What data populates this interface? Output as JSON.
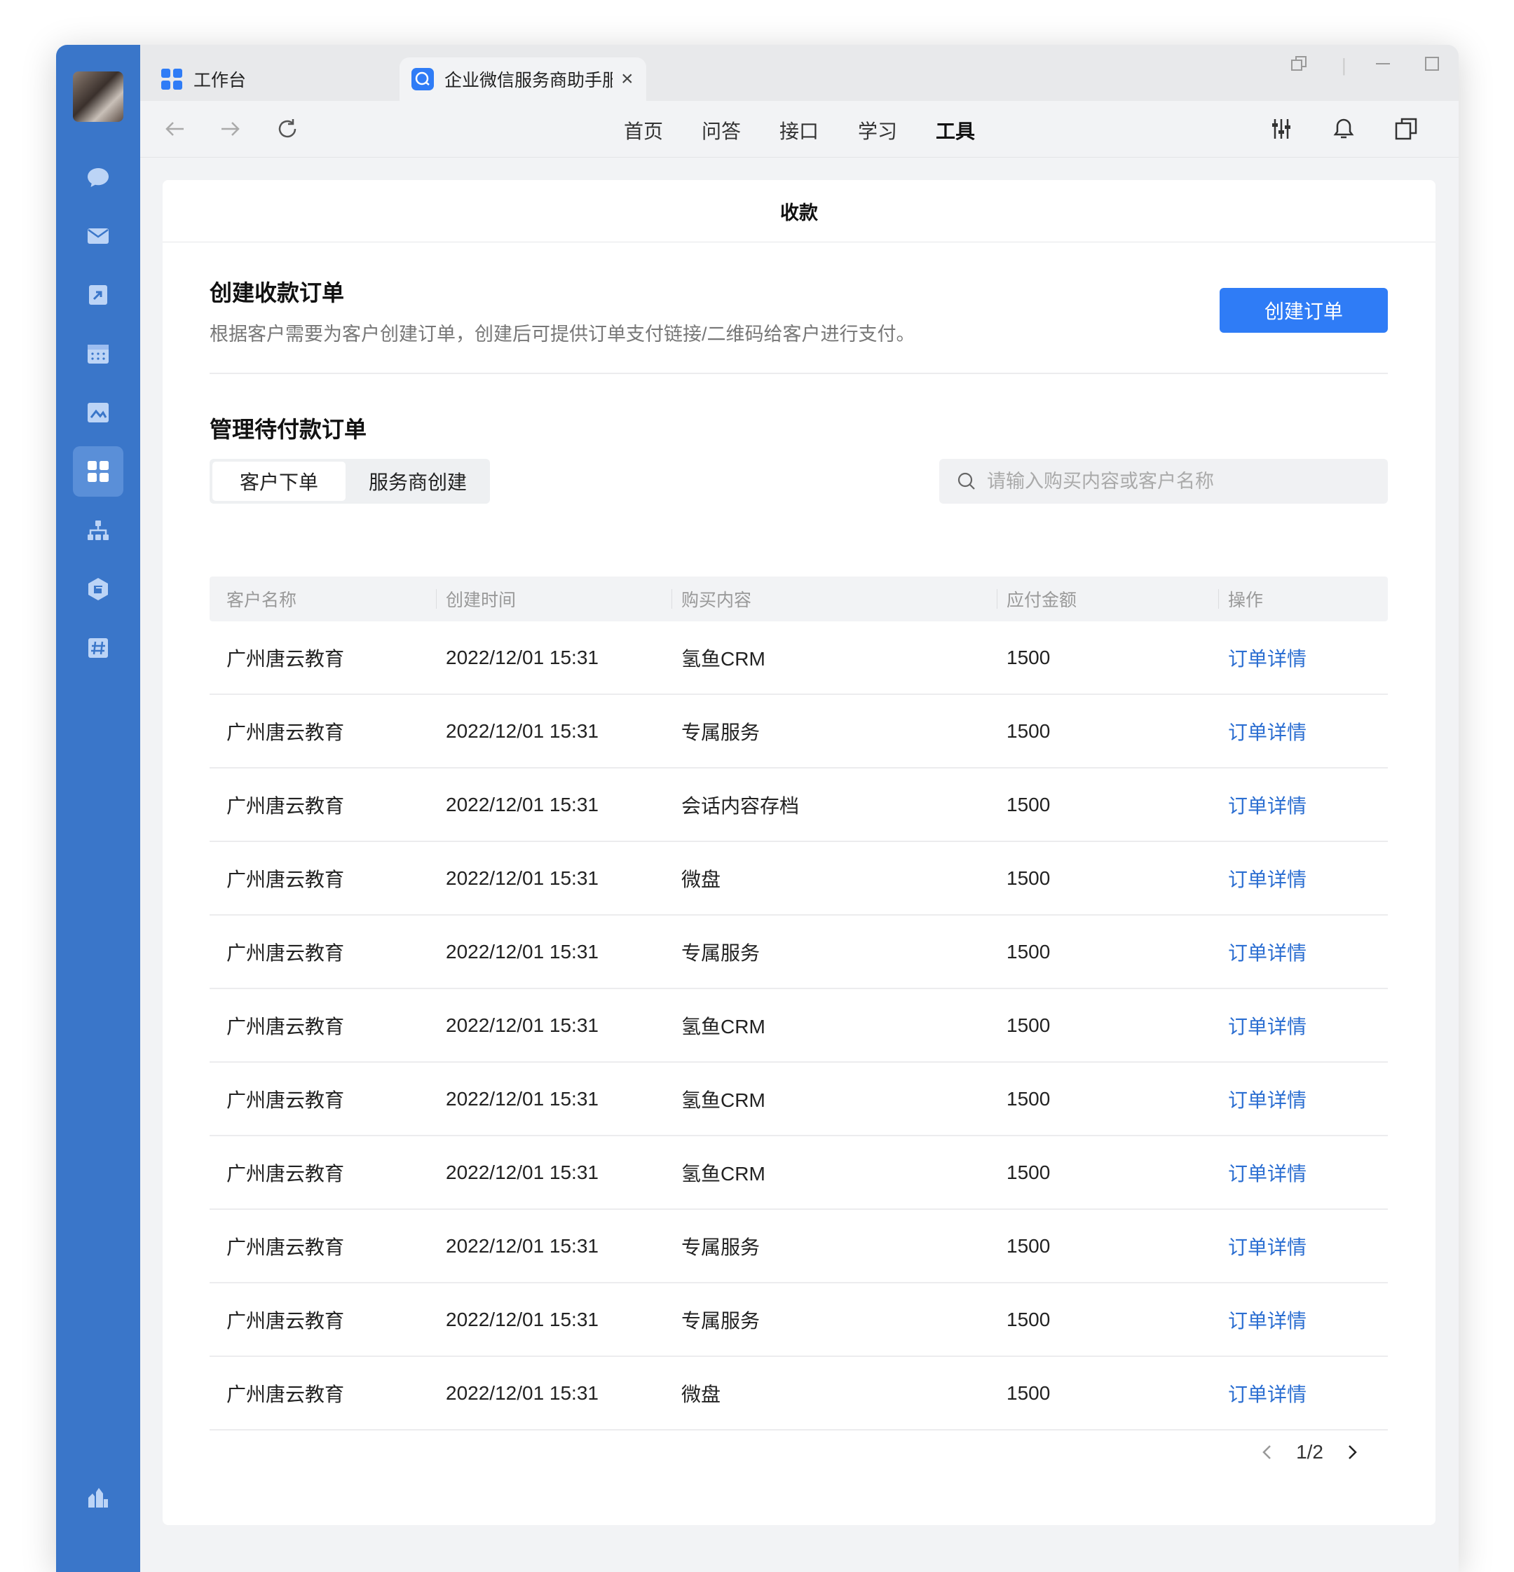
{
  "tabs": [
    {
      "label": "工作台"
    },
    {
      "label": "企业微信服务商助手服"
    }
  ],
  "nav": {
    "menu": [
      "首页",
      "问答",
      "接口",
      "学习",
      "工具"
    ],
    "active": "工具"
  },
  "page": {
    "title": "收款",
    "create": {
      "heading": "创建收款订单",
      "description": "根据客户需要为客户创建订单，创建后可提供订单支付链接/二维码给客户进行支付。",
      "button": "创建订单"
    },
    "manage": {
      "heading": "管理待付款订单",
      "segments": [
        "客户下单",
        "服务商创建"
      ],
      "search_placeholder": "请输入购买内容或客户名称"
    },
    "table": {
      "columns": [
        "客户名称",
        "创建时间",
        "购买内容",
        "应付金额",
        "操作"
      ],
      "rows": [
        {
          "customer": "广州唐云教育",
          "time": "2022/12/01 15:31",
          "item": "氢鱼CRM",
          "amount": "1500",
          "action": "订单详情"
        },
        {
          "customer": "广州唐云教育",
          "time": "2022/12/01 15:31",
          "item": "专属服务",
          "amount": "1500",
          "action": "订单详情"
        },
        {
          "customer": "广州唐云教育",
          "time": "2022/12/01 15:31",
          "item": "会话内容存档",
          "amount": "1500",
          "action": "订单详情"
        },
        {
          "customer": "广州唐云教育",
          "time": "2022/12/01 15:31",
          "item": "微盘",
          "amount": "1500",
          "action": "订单详情"
        },
        {
          "customer": "广州唐云教育",
          "time": "2022/12/01 15:31",
          "item": "专属服务",
          "amount": "1500",
          "action": "订单详情"
        },
        {
          "customer": "广州唐云教育",
          "time": "2022/12/01 15:31",
          "item": "氢鱼CRM",
          "amount": "1500",
          "action": "订单详情"
        },
        {
          "customer": "广州唐云教育",
          "time": "2022/12/01 15:31",
          "item": "氢鱼CRM",
          "amount": "1500",
          "action": "订单详情"
        },
        {
          "customer": "广州唐云教育",
          "time": "2022/12/01 15:31",
          "item": "氢鱼CRM",
          "amount": "1500",
          "action": "订单详情"
        },
        {
          "customer": "广州唐云教育",
          "time": "2022/12/01 15:31",
          "item": "专属服务",
          "amount": "1500",
          "action": "订单详情"
        },
        {
          "customer": "广州唐云教育",
          "time": "2022/12/01 15:31",
          "item": "专属服务",
          "amount": "1500",
          "action": "订单详情"
        },
        {
          "customer": "广州唐云教育",
          "time": "2022/12/01 15:31",
          "item": "微盘",
          "amount": "1500",
          "action": "订单详情"
        }
      ]
    },
    "pagination": {
      "text": "1/2"
    }
  },
  "colors": {
    "sidebar": "#3a76c9",
    "primary": "#2f7cf6",
    "link": "#2b6ed1"
  },
  "icons": {
    "sidebar": [
      "chat-icon",
      "mail-icon",
      "docs-icon",
      "calendar-icon",
      "drive-icon",
      "workbench-icon",
      "org-chart-icon",
      "apps-icon",
      "hashtag-icon",
      "settings-icon"
    ]
  }
}
